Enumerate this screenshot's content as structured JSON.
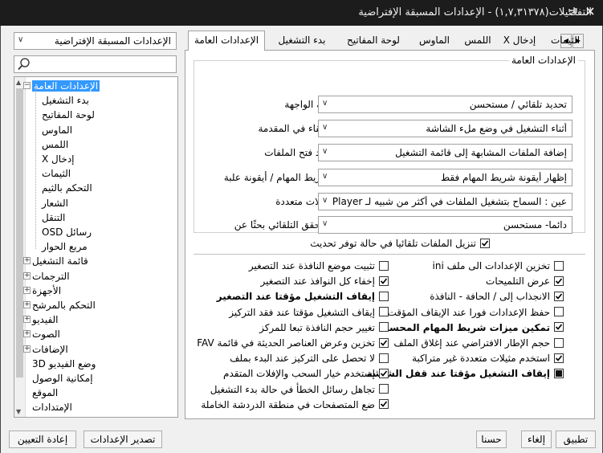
{
  "window": {
    "title": "التفضيلات(١,٧,٣١٣٧٨) - الإعدادات المسبقة الإفتراضية",
    "pin_icon": "pin-icon",
    "close_icon": "close-icon"
  },
  "sidebar": {
    "preset_value": "الإعدادات المسبقة الإفتراضية",
    "search_value": "",
    "tree": [
      {
        "label": "الإعدادات العامة",
        "level": 0,
        "expander": "-",
        "selected": true
      },
      {
        "label": "بدء التشغيل",
        "level": 1
      },
      {
        "label": "لوحة المفاتيح",
        "level": 1
      },
      {
        "label": "الماوس",
        "level": 1
      },
      {
        "label": "اللمس",
        "level": 1
      },
      {
        "label": "إدخال X",
        "level": 1
      },
      {
        "label": "الثيمات",
        "level": 1
      },
      {
        "label": "التحكم بالثيم",
        "level": 1
      },
      {
        "label": "الشعار",
        "level": 1
      },
      {
        "label": "التنقل",
        "level": 1
      },
      {
        "label": "رسائل OSD",
        "level": 1
      },
      {
        "label": "مربع الحوار",
        "level": 1
      },
      {
        "label": "قائمة التشغيل",
        "level": 0,
        "expander": "+"
      },
      {
        "label": "الترجمات",
        "level": 0,
        "expander": "+"
      },
      {
        "label": "الأجهزة",
        "level": 0,
        "expander": "+"
      },
      {
        "label": "التحكم بالمرشح",
        "level": 0,
        "expander": "+"
      },
      {
        "label": "الفيديو",
        "level": 0,
        "expander": "+"
      },
      {
        "label": "الصوت",
        "level": 0,
        "expander": "+"
      },
      {
        "label": "الإضافات",
        "level": 0,
        "expander": "+"
      },
      {
        "label": "وضع الفيديو 3D",
        "level": 0
      },
      {
        "label": "إمكانية الوصول",
        "level": 0
      },
      {
        "label": "الموقع",
        "level": 0
      },
      {
        "label": "الإمتدادات",
        "level": 0
      }
    ]
  },
  "tabs": [
    {
      "label": "الإعدادات العامة",
      "active": true
    },
    {
      "label": "بدء التشغيل"
    },
    {
      "label": "لوحة المفاتيح"
    },
    {
      "label": "الماوس"
    },
    {
      "label": "اللمس"
    },
    {
      "label": "إدخال X"
    },
    {
      "label": "الثيمات"
    }
  ],
  "general": {
    "group_title": "الإعدادات العامة",
    "rows": [
      {
        "label": "لغة الواجهة",
        "value": "تحديد تلقائي / مستحسن"
      },
      {
        "label": "البقاء في المقدمة",
        "value": "أثناء التشغيل في وضع ملء الشاشة"
      },
      {
        "label": "عند فتح الملفات",
        "value": "إضافة الملفات المشابهة إلى قائمة التشغيل"
      },
      {
        "label": "شريط المهام / أيقونة علبة",
        "value": "إظهار أيقونة شريط المهام فقط"
      },
      {
        "label": "حالات متعددة",
        "value": "عين : السماح بتشغيل الملفات في أكثر من شبيه لـ PotPlayer"
      },
      {
        "label": "التحقق التلقائي بحثًا عن",
        "value": "دائما- مستحسن"
      }
    ],
    "auto_download": {
      "label": "تنزيل الملفات تلقائيا في حالة توفر تحديث",
      "checked": true
    }
  },
  "options_right": [
    {
      "label": "تخزين الإعدادات الى ملف ini",
      "checked": false,
      "bold": false
    },
    {
      "label": "عرض التلميحات",
      "checked": true,
      "bold": false
    },
    {
      "label": "الانجذاب إلى / الحافة - النافذة",
      "checked": true,
      "bold": false
    },
    {
      "label": "حفظ الإعدادات فورا عند الإيقاف المؤقت",
      "checked": false,
      "bold": false
    },
    {
      "label": "تمكين ميزات شريط المهام المحسنة",
      "checked": true,
      "bold": true
    },
    {
      "label": "حجم الإطار الافتراضي عند إغلاق الملف",
      "checked": false,
      "bold": false
    },
    {
      "label": "استخدم مثيلات متعددة غير متراكبة",
      "checked": true,
      "bold": false
    },
    {
      "label": "إيقاف التشغيل مؤقتا عند قفل الشاشة",
      "checked": "partial",
      "bold": true
    }
  ],
  "options_left": [
    {
      "label": "تثبيت موضع النافذة عند التصغير",
      "checked": false,
      "bold": false
    },
    {
      "label": "إخفاء كل النوافذ عند التصغير",
      "checked": true,
      "bold": false
    },
    {
      "label": "إيقاف التشغيل مؤقتا عند التصغير",
      "checked": false,
      "bold": true
    },
    {
      "label": "إيقاف التشغيل مؤقتا عند فقد التركيز",
      "checked": false,
      "bold": false
    },
    {
      "label": "تغيير حجم النافذة تبعا للمركز",
      "checked": false,
      "bold": false
    },
    {
      "label": "تخزين وعرض العناصر الحديثة في قائمة FAV",
      "checked": true,
      "bold": false
    },
    {
      "label": "لا تحصل على التركيز عند البدء بملف",
      "checked": false,
      "bold": false
    },
    {
      "label": "إستخدم خيار السحب والإفلات المتقدم",
      "checked": true,
      "bold": false
    },
    {
      "label": "تجاهل رسائل الخطأ في حالة بدء التشغيل",
      "checked": false,
      "bold": false
    },
    {
      "label": "ضع المتصفحات في منطقة الدردشة الخاملة",
      "checked": true,
      "bold": false
    }
  ],
  "buttons": {
    "apply": "تطبيق",
    "cancel": "إلغاء",
    "ok": "حسنا",
    "export": "تصدير الإعدادات",
    "reset": "إعادة التعيين"
  }
}
